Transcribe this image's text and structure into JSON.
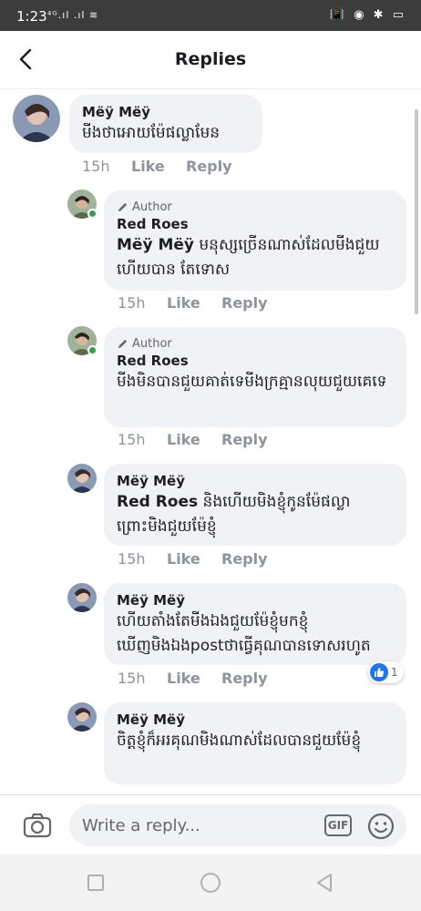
{
  "status_bar": {
    "time": "1:23",
    "left_icons": "⁴ᴳ.ıl .ıl ≋",
    "right_icons": "📳 ◉ ✱ ▭"
  },
  "header": {
    "title": "Replies"
  },
  "comments": [
    {
      "author": "Mëÿ Mëÿ",
      "text": "មីងថាអោយម៉ែផល្លាមែន",
      "time": "15h",
      "like": "Like",
      "reply": "Reply"
    },
    {
      "badge": "Author",
      "author": "Red Roes",
      "mention": "Mëÿ Mëÿ",
      "text": " មនុស្សច្រើនណាស់ដែលមីងជួយហើយបាន តែទោស",
      "time": "15h",
      "like": "Like",
      "reply": "Reply"
    },
    {
      "badge": "Author",
      "author": "Red Roes",
      "text": "មីងមិនបានជួយគាត់ទេមីងក្រគ្មានលុយជួយគេទេ",
      "time": "15h",
      "like": "Like",
      "reply": "Reply"
    },
    {
      "author": "Mëÿ Mëÿ",
      "mention": "Red Roes",
      "text": " និងហើយមិងខ្ញុំកូនម៉ែផល្លា ព្រោះមិងជួយម៉ែខ្ញុំ",
      "time": "15h",
      "like": "Like",
      "reply": "Reply"
    },
    {
      "author": "Mëÿ Mëÿ",
      "text": "ហើយតាំងតែមីងឯងជួយម៉ែខ្ញុំមកខ្ញុំឃើញមិងឯងpostថាធ្វើគុណបានទោសរហូត",
      "time": "15h",
      "like": "Like",
      "reply": "Reply",
      "reaction_count": "1"
    },
    {
      "author": "Mëÿ Mëÿ",
      "text": "ចិត្តខ្ញុំក៏អរគុណមិងណាស់ដែលបានជួយម៉ែខ្ញុំ"
    }
  ],
  "composer": {
    "placeholder": "Write a reply...",
    "gif_label": "GIF"
  },
  "colors": {
    "bubble": "#f0f2f5",
    "like_blue": "#1877f2",
    "online_green": "#31a24c",
    "meta_gray": "#8d949e"
  }
}
